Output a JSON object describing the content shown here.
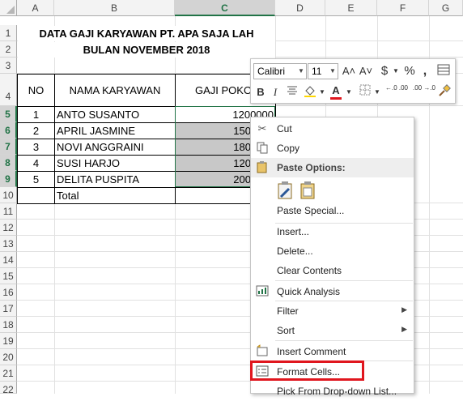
{
  "columns": [
    "A",
    "B",
    "C",
    "D",
    "E",
    "F",
    "G"
  ],
  "rows": [
    "1",
    "2",
    "3",
    "4",
    "5",
    "6",
    "7",
    "8",
    "9",
    "10",
    "11",
    "12",
    "13",
    "14",
    "15",
    "16",
    "17",
    "18",
    "19",
    "20",
    "21",
    "22"
  ],
  "title1": "DATA GAJI KARYAWAN PT. APA SAJA LAH",
  "title2": "BULAN NOVEMBER 2018",
  "headers": {
    "no": "NO",
    "nama": "NAMA KARYAWAN",
    "gaji": "GAJI POKOK"
  },
  "records": [
    {
      "no": "1",
      "nama": "ANTO SUSANTO",
      "gaji": "1200000"
    },
    {
      "no": "2",
      "nama": "APRIL JASMINE",
      "gaji": "150"
    },
    {
      "no": "3",
      "nama": "NOVI ANGGRAINI",
      "gaji": "180"
    },
    {
      "no": "4",
      "nama": "SUSI HARJO",
      "gaji": "120"
    },
    {
      "no": "5",
      "nama": "DELITA PUSPITA",
      "gaji": "200"
    }
  ],
  "total_label": "Total",
  "minibar": {
    "font": "Calibri",
    "size": "11",
    "grow": "A˄",
    "shrink": "A˅",
    "currency": "$",
    "percent": "%",
    "comma": ",",
    "bold": "B",
    "italic": "I",
    "fontcolor": "A",
    "inc_decimal": "←.0 .00",
    "dec_decimal": ".00 →.0"
  },
  "menu": {
    "cut": "Cut",
    "copy": "Copy",
    "paste_options": "Paste Options:",
    "paste_special": "Paste Special...",
    "insert": "Insert...",
    "delete": "Delete...",
    "clear_contents": "Clear Contents",
    "quick_analysis": "Quick Analysis",
    "filter": "Filter",
    "sort": "Sort",
    "insert_comment": "Insert Comment",
    "format_cells": "Format Cells...",
    "pick_dropdown": "Pick From Drop-down List..."
  },
  "colors": {
    "accent": "#217346",
    "highlight": "#e0161e",
    "selection_fill": "#c8c8c8"
  }
}
